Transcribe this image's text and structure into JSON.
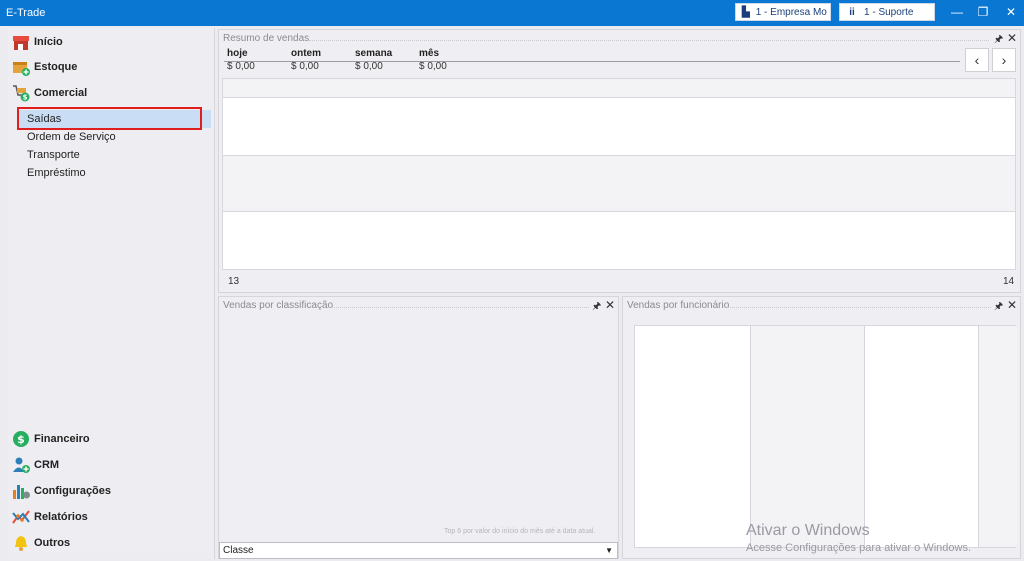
{
  "window": {
    "title": "E-Trade"
  },
  "header": {
    "company_button": "1 - Empresa Mo",
    "user_button": "1 - Suporte",
    "minimize": "—",
    "restore": "❐",
    "close": "✕"
  },
  "sidebar": {
    "main_items": [
      {
        "label": "Início",
        "icon": "store-icon"
      },
      {
        "label": "Estoque",
        "icon": "box-plus-icon"
      },
      {
        "label": "Comercial",
        "icon": "cart-dollar-icon"
      }
    ],
    "sub_items": [
      {
        "label": "Saídas"
      },
      {
        "label": "Ordem de Serviço"
      },
      {
        "label": "Transporte"
      },
      {
        "label": "Empréstimo"
      }
    ],
    "bottom_items": [
      {
        "label": "Financeiro",
        "icon": "dollar-circle-icon"
      },
      {
        "label": "CRM",
        "icon": "user-plus-icon"
      },
      {
        "label": "Configurações",
        "icon": "settings-bars-icon"
      },
      {
        "label": "Relatórios",
        "icon": "report-graph-icon"
      },
      {
        "label": "Outros",
        "icon": "bell-icon"
      }
    ]
  },
  "resumo": {
    "title": "Resumo de vendas",
    "columns": [
      {
        "label": "hoje",
        "value": "$ 0,00"
      },
      {
        "label": "ontem",
        "value": "$ 0,00"
      },
      {
        "label": "semana",
        "value": "$ 0,00"
      },
      {
        "label": "mês",
        "value": "$ 0,00"
      }
    ],
    "prev": "‹",
    "next": "›",
    "axis_left": "13",
    "axis_right": "14"
  },
  "classificacao": {
    "title": "Vendas por classificação",
    "footnote": "Top 6 por valor do início do mês até a data atual.",
    "select_value": "Classe"
  },
  "funcionario": {
    "title": "Vendas por funcionário"
  },
  "panel_controls": {
    "pin": "🖈",
    "close": "✕"
  },
  "watermark": {
    "line1": "Ativar o Windows",
    "line2": "Acesse Configurações para ativar o Windows."
  },
  "colors": {
    "titlebar": "#0a77d3",
    "selected": "#c9def5",
    "highlight": "#e01e1e"
  }
}
